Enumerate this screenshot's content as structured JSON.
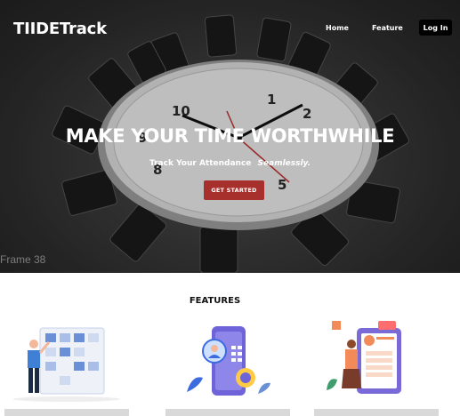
{
  "header": {
    "brand": "TIIDETrack",
    "nav": {
      "home": "Home",
      "feature": "Feature",
      "login": "Log In"
    }
  },
  "hero": {
    "title": "MAKE YOUR TIME WORTHWHILE",
    "subtitle_lead": "Track Your Attendance",
    "subtitle_emphasis": "Seamlessly.",
    "cta": "GET STARTED",
    "frame_label": "Frame 38"
  },
  "features": {
    "title": "FEATURES",
    "cards": [
      {
        "illustration": "person-with-task-board"
      },
      {
        "illustration": "phone-with-profile-and-calendar"
      },
      {
        "illustration": "person-with-tablet-profile"
      }
    ]
  },
  "colors": {
    "cta_bg": "#a8302c",
    "login_bg": "#000000",
    "card_bar": "#d9d9d9"
  }
}
